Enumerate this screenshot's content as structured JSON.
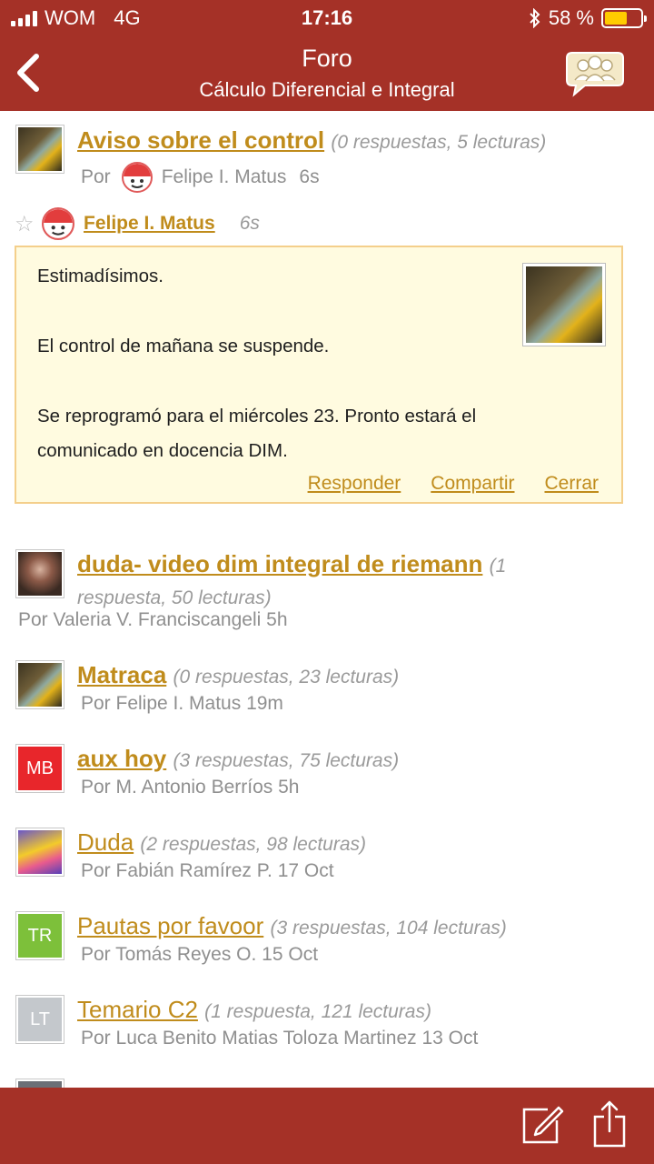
{
  "status": {
    "carrier": "WOM",
    "network": "4G",
    "time": "17:16",
    "battery": "58 %"
  },
  "header": {
    "title": "Foro",
    "subtitle": "Cálculo Diferencial e Integral"
  },
  "expanded": {
    "topic_title": "Aviso sobre el control",
    "topic_meta": "(0 respuestas, 5 lecturas)",
    "by_prefix": "Por",
    "by_name": "Felipe I. Matus",
    "by_age": "6s",
    "author": "Felipe I. Matus",
    "age": "6s",
    "message": {
      "p1": "Estimadísimos.",
      "p2": "El control de mañana se suspende.",
      "p3a": "Se reprogramó para el miércoles 23. Pronto estará el",
      "p3b": "comunicado en docencia DIM."
    },
    "actions": {
      "reply": "Responder",
      "share": "Compartir",
      "close": "Cerrar"
    }
  },
  "topics": [
    {
      "title": "duda- video dim integral de riemann",
      "meta_a": "(1",
      "meta_b": "respuesta, 50 lecturas)",
      "by": "Por Valeria V. Franciscangeli  5h"
    },
    {
      "title": "Matraca",
      "meta": "(0 respuestas, 23 lecturas)",
      "by": "Por Felipe I. Matus  19m"
    },
    {
      "title": "aux hoy",
      "meta": "(3 respuestas, 75 lecturas)",
      "by": "Por M. Antonio Berríos  5h",
      "initials": "MB",
      "color": "#e8262b"
    },
    {
      "title": "Duda",
      "meta": "(2 respuestas, 98 lecturas)",
      "by": "Por Fabián Ramírez P.  17 Oct"
    },
    {
      "title": "Pautas por favoor",
      "meta": "(3 respuestas, 104 lecturas)",
      "by": "Por Tomás Reyes O.  15 Oct",
      "initials": "TR",
      "color": "#7dc03a"
    },
    {
      "title": "Temario C2",
      "meta": "(1 respuesta, 121 lecturas)",
      "by": "Por Luca Benito Matias Toloza Martinez  13 Oct",
      "initials": "LT",
      "color": "#c4c8cc"
    }
  ],
  "icons": {
    "back": "chevron-left-icon",
    "forum": "forum-users-icon",
    "compose": "compose-icon",
    "share": "share-icon",
    "star": "star-icon"
  },
  "colors": {
    "bar": "#a53127",
    "link": "#c08c1c",
    "message_bg": "#fffbe0"
  }
}
